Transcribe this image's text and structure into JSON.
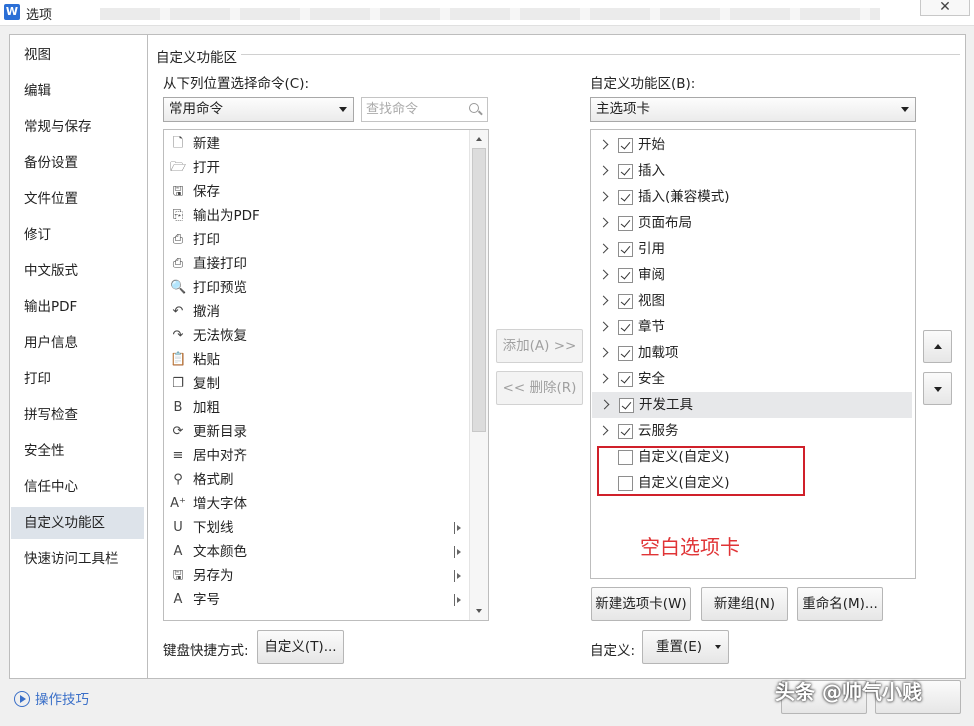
{
  "window": {
    "title": "选项",
    "app_icon": "W",
    "close_glyph": "✕"
  },
  "nav": {
    "items": [
      {
        "label": "视图",
        "active": false
      },
      {
        "label": "编辑",
        "active": false
      },
      {
        "label": "常规与保存",
        "active": false
      },
      {
        "label": "备份设置",
        "active": false
      },
      {
        "label": "文件位置",
        "active": false
      },
      {
        "label": "修订",
        "active": false
      },
      {
        "label": "中文版式",
        "active": false
      },
      {
        "label": "输出PDF",
        "active": false
      },
      {
        "label": "用户信息",
        "active": false
      },
      {
        "label": "打印",
        "active": false
      },
      {
        "label": "拼写检查",
        "active": false
      },
      {
        "label": "安全性",
        "active": false
      },
      {
        "label": "信任中心",
        "active": false
      },
      {
        "label": "自定义功能区",
        "active": true
      },
      {
        "label": "快速访问工具栏",
        "active": false
      }
    ],
    "tips_label": "操作技巧"
  },
  "section_title": "自定义功能区",
  "left": {
    "label": "从下列位置选择命令(C):",
    "source_select": "常用命令",
    "search_placeholder": "查找命令",
    "commands": [
      {
        "label": "新建",
        "icon": "new-doc-icon",
        "glyph": "🗋",
        "submenu": false
      },
      {
        "label": "打开",
        "icon": "open-folder-icon",
        "glyph": "🗁",
        "submenu": false
      },
      {
        "label": "保存",
        "icon": "save-icon",
        "glyph": "🖫",
        "submenu": false
      },
      {
        "label": "输出为PDF",
        "icon": "pdf-icon",
        "glyph": "⎘",
        "submenu": false
      },
      {
        "label": "打印",
        "icon": "printer-icon",
        "glyph": "⎙",
        "submenu": false
      },
      {
        "label": "直接打印",
        "icon": "direct-print-icon",
        "glyph": "⎙",
        "submenu": false
      },
      {
        "label": "打印预览",
        "icon": "print-preview-icon",
        "glyph": "🔍",
        "submenu": false
      },
      {
        "label": "撤消",
        "icon": "undo-icon",
        "glyph": "↶",
        "submenu": false
      },
      {
        "label": "无法恢复",
        "icon": "redo-icon",
        "glyph": "↷",
        "submenu": false
      },
      {
        "label": "粘贴",
        "icon": "paste-icon",
        "glyph": "📋",
        "submenu": false
      },
      {
        "label": "复制",
        "icon": "copy-icon",
        "glyph": "❐",
        "submenu": false
      },
      {
        "label": "加粗",
        "icon": "bold-icon",
        "glyph": "B",
        "submenu": false
      },
      {
        "label": "更新目录",
        "icon": "update-toc-icon",
        "glyph": "⟳",
        "submenu": false
      },
      {
        "label": "居中对齐",
        "icon": "align-center-icon",
        "glyph": "≡",
        "submenu": false
      },
      {
        "label": "格式刷",
        "icon": "format-painter-icon",
        "glyph": "⚲",
        "submenu": false
      },
      {
        "label": "增大字体",
        "icon": "grow-font-icon",
        "glyph": "A⁺",
        "submenu": false
      },
      {
        "label": "下划线",
        "icon": "underline-icon",
        "glyph": "U",
        "submenu": true
      },
      {
        "label": "文本颜色",
        "icon": "text-color-icon",
        "glyph": "A",
        "submenu": true
      },
      {
        "label": "另存为",
        "icon": "save-as-icon",
        "glyph": "🖫",
        "submenu": true
      },
      {
        "label": "字号",
        "icon": "font-size-icon",
        "glyph": "A",
        "submenu": true
      }
    ]
  },
  "middle": {
    "add_label": "添加(A) >>",
    "remove_label": "<< 删除(R)"
  },
  "right": {
    "label": "自定义功能区(B):",
    "tabs_select": "主选项卡",
    "tree": [
      {
        "label": "开始",
        "checked": true,
        "expandable": true,
        "selected": false
      },
      {
        "label": "插入",
        "checked": true,
        "expandable": true,
        "selected": false
      },
      {
        "label": "插入(兼容模式)",
        "checked": true,
        "expandable": true,
        "selected": false
      },
      {
        "label": "页面布局",
        "checked": true,
        "expandable": true,
        "selected": false
      },
      {
        "label": "引用",
        "checked": true,
        "expandable": true,
        "selected": false
      },
      {
        "label": "审阅",
        "checked": true,
        "expandable": true,
        "selected": false
      },
      {
        "label": "视图",
        "checked": true,
        "expandable": true,
        "selected": false
      },
      {
        "label": "章节",
        "checked": true,
        "expandable": true,
        "selected": false
      },
      {
        "label": "加载项",
        "checked": true,
        "expandable": true,
        "selected": false
      },
      {
        "label": "安全",
        "checked": true,
        "expandable": true,
        "selected": false
      },
      {
        "label": "开发工具",
        "checked": true,
        "expandable": true,
        "selected": true
      },
      {
        "label": "云服务",
        "checked": true,
        "expandable": true,
        "selected": false
      },
      {
        "label": "自定义(自定义)",
        "checked": false,
        "expandable": false,
        "selected": false
      },
      {
        "label": "自定义(自定义)",
        "checked": false,
        "expandable": false,
        "selected": false
      }
    ],
    "annotation": "空白选项卡",
    "annotation_color": "#e03436",
    "new_tab_label": "新建选项卡(W)",
    "new_group_label": "新建组(N)",
    "rename_label": "重命名(M)...",
    "customize_label": "自定义:",
    "reset_label": "重置(E)"
  },
  "shortcut": {
    "label": "键盘快捷方式:",
    "button_label": "自定义(T)..."
  },
  "watermark": "头条 @帅气小贱"
}
